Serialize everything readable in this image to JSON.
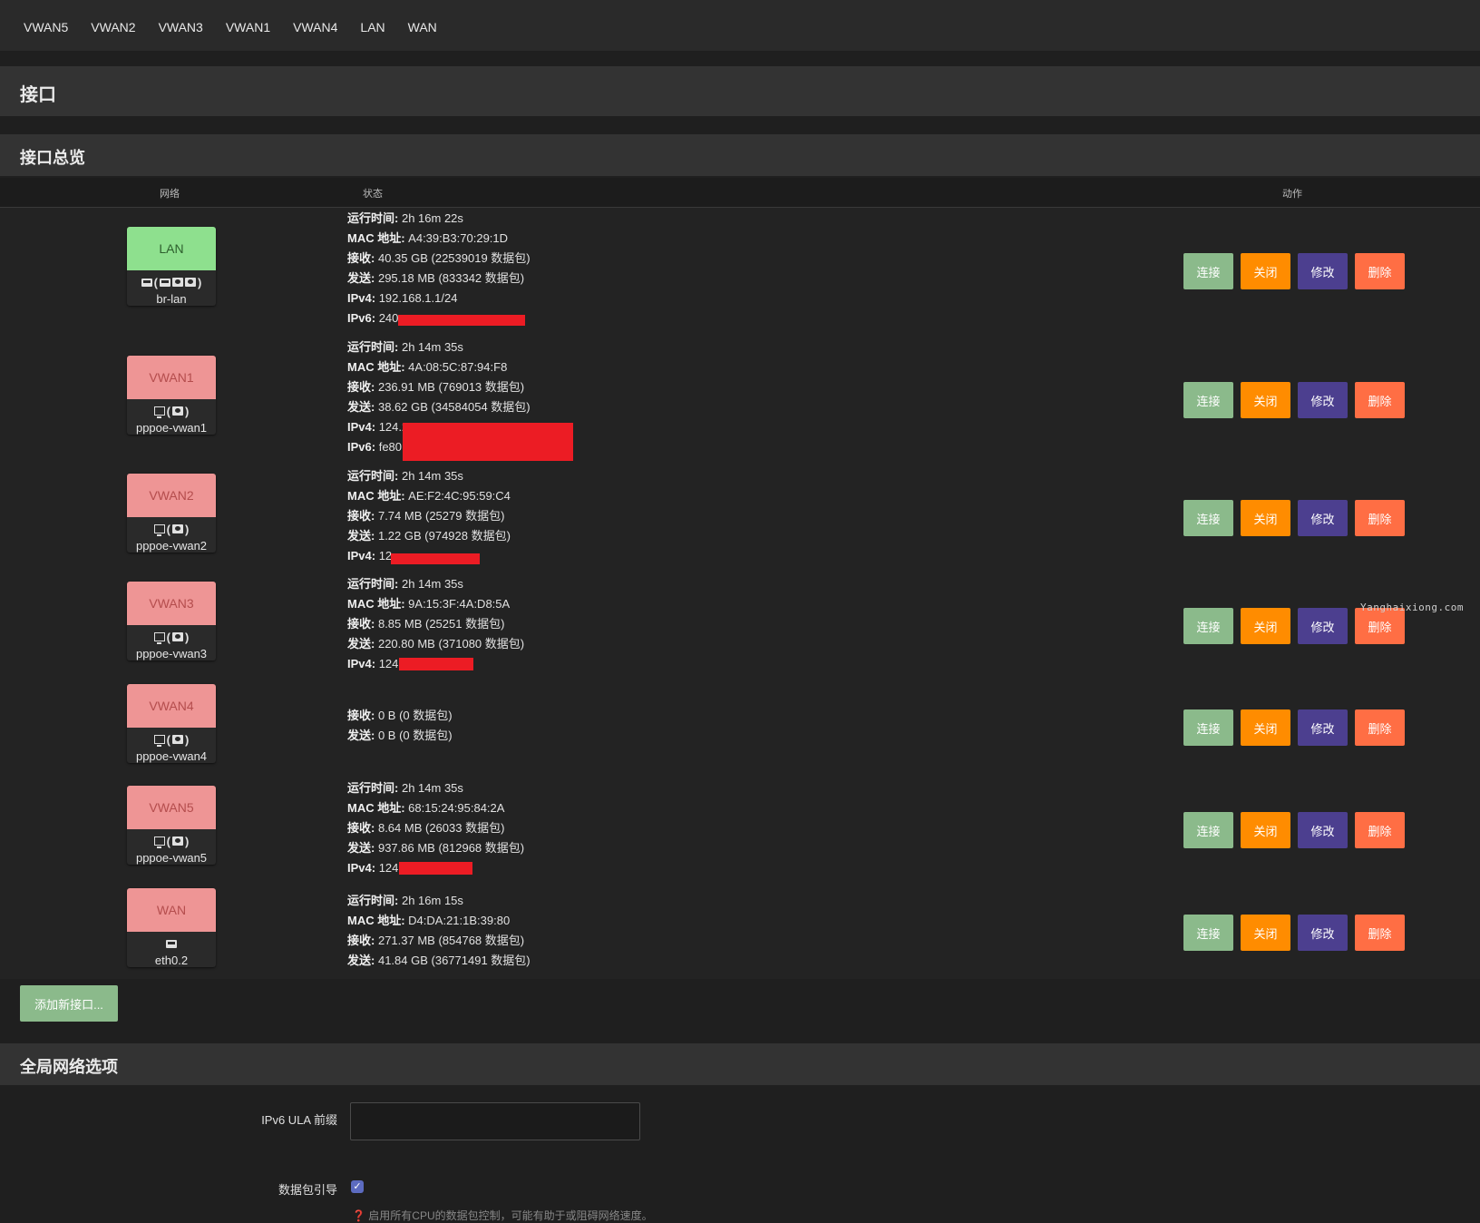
{
  "tabs": [
    "VWAN5",
    "VWAN2",
    "VWAN3",
    "VWAN1",
    "VWAN4",
    "LAN",
    "WAN"
  ],
  "page_title": "接口",
  "overview_title": "接口总览",
  "columns": {
    "network": "网络",
    "status": "状态",
    "actions": "动作"
  },
  "buttons": {
    "connect": "连接",
    "close": "关闭",
    "edit": "修改",
    "delete": "删除"
  },
  "labels": {
    "uptime": "运行时间:",
    "mac": "MAC 地址:",
    "rx": "接收:",
    "tx": "发送:",
    "ipv4": "IPv4:",
    "ipv6": "IPv6:"
  },
  "interfaces": [
    {
      "name": "LAN",
      "device": "br-lan",
      "color": "green",
      "uptime": "2h 16m 22s",
      "mac": "A4:39:B3:70:29:1D",
      "rx": "40.35 GB (22539019 数据包)",
      "tx": "295.18 MB (833342 数据包)",
      "ipv4": "192.168.1.1/24",
      "ipv6": "240"
    },
    {
      "name": "VWAN1",
      "device": "pppoe-vwan1",
      "color": "red",
      "uptime": "2h 14m 35s",
      "mac": "4A:08:5C:87:94:F8",
      "rx": "236.91 MB (769013 数据包)",
      "tx": "38.62 GB (34584054 数据包)",
      "ipv4": "124.2",
      "ipv6": "fe80"
    },
    {
      "name": "VWAN2",
      "device": "pppoe-vwan2",
      "color": "red",
      "uptime": "2h 14m 35s",
      "mac": "AE:F2:4C:95:59:C4",
      "rx": "7.74 MB (25279 数据包)",
      "tx": "1.22 GB (974928 数据包)",
      "ipv4": "12"
    },
    {
      "name": "VWAN3",
      "device": "pppoe-vwan3",
      "color": "red",
      "uptime": "2h 14m 35s",
      "mac": "9A:15:3F:4A:D8:5A",
      "rx": "8.85 MB (25251 数据包)",
      "tx": "220.80 MB (371080 数据包)",
      "ipv4": "124."
    },
    {
      "name": "VWAN4",
      "device": "pppoe-vwan4",
      "color": "red",
      "rx": "0 B (0 数据包)",
      "tx": "0 B (0 数据包)"
    },
    {
      "name": "VWAN5",
      "device": "pppoe-vwan5",
      "color": "red",
      "uptime": "2h 14m 35s",
      "mac": "68:15:24:95:84:2A",
      "rx": "8.64 MB (26033 数据包)",
      "tx": "937.86 MB (812968 数据包)",
      "ipv4": "124."
    },
    {
      "name": "WAN",
      "device": "eth0.2",
      "color": "red",
      "uptime": "2h 16m 15s",
      "mac": "D4:DA:21:1B:39:80",
      "rx": "271.37 MB (854768 数据包)",
      "tx": "41.84 GB (36771491 数据包)"
    }
  ],
  "add_button": "添加新接口...",
  "global_title": "全局网络选项",
  "ula_label": "IPv6 ULA 前缀",
  "ula_value": "",
  "steering_label": "数据包引导",
  "steering_hint": "❓ 启用所有CPU的数据包控制，可能有助于或阻碍网络速度。",
  "watermark": "Yanghaixiong.com",
  "colors": {
    "badge_green": "#8ee08e",
    "badge_red": "#ee9595",
    "connect": "#8bba8b",
    "close": "#ff8c00",
    "edit": "#4c3f8f",
    "delete": "#ff6e44"
  }
}
